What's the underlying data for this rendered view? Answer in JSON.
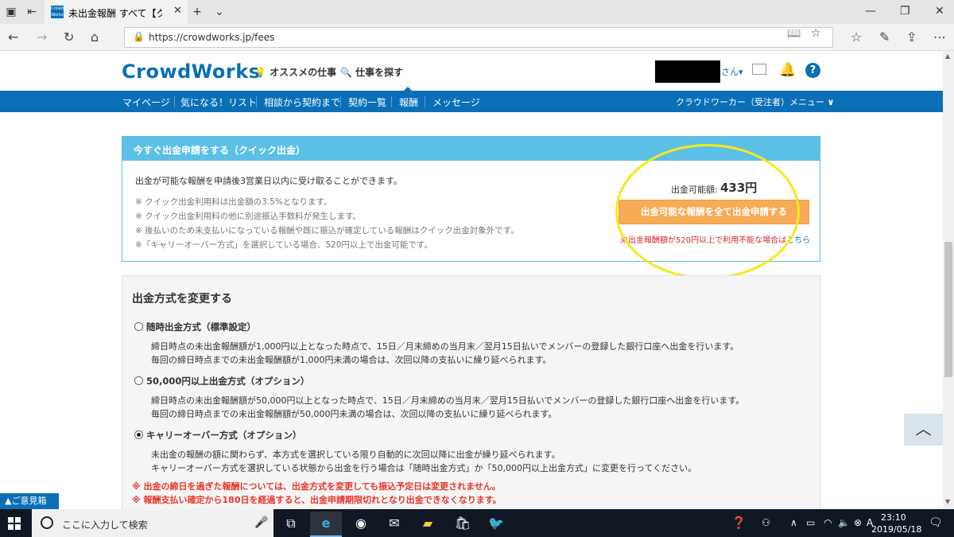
{
  "browser": {
    "tab_title": "未出金報酬 すべて【クラウ",
    "url": "https://crowdworks.jp/fees",
    "icons": [
      "tab-list-icon",
      "back-tab-icon",
      "new-tab-icon",
      "tab-dropdown-icon",
      "minimize-icon",
      "maximize-icon",
      "window-close-icon",
      "back-icon",
      "forward-icon",
      "refresh-icon",
      "home-icon",
      "lock-icon",
      "reading-view-icon",
      "favorite-star-icon",
      "favorites-icon",
      "pen-icon",
      "share-icon",
      "more-icon"
    ]
  },
  "site": {
    "logo": "CrowdWorks",
    "recommended_jobs": "オススメの仕事",
    "find_jobs": "仕事を探す",
    "user_suffix": "さん",
    "nav": [
      "マイページ",
      "気になる！リスト",
      "相談から契約まで",
      "契約一覧",
      "報酬",
      "メッセージ"
    ],
    "nav_active": "報酬",
    "worker_menu": "クラウドワーカー（受注者）メニュー"
  },
  "quick": {
    "title": "今すぐ出金申請をする（クイック出金）",
    "description": "出金が可能な報酬を申請後3営業日以内に受け取ることができます。",
    "notes": [
      "※ クイック出金利用料は出金額の3.5%となります。",
      "※ クイック出金利用料の他に別途振込手数料が発生します。",
      "※ 後払いのため未支払いになっている報酬や既に振込が確定している報酬はクイック出金対象外です。",
      "※「キャリーオーバー方式」を選択している場合、520円以上で出金可能です。"
    ],
    "available_label": "出金可能額:",
    "available_amount": "433円",
    "button": "出金可能な報酬を全て出金申請する",
    "restriction_text": "未出金報酬額が520円以上で利用不能な場合は",
    "restriction_link": "こちら"
  },
  "method": {
    "title": "出金方式を変更する",
    "options": [
      {
        "label": "随時出金方式（標準設定）",
        "lines": [
          "締日時点の未出金報酬額が1,000円以上となった時点で、15日／月末締めの当月末／翌月15日払いでメンバーの登録した銀行口座へ出金を行います。",
          "毎回の締日時点までの未出金報酬額が1,000円未満の場合は、次回以降の支払いに繰り延べられます。"
        ],
        "checked": false
      },
      {
        "label": "50,000円以上出金方式（オプション）",
        "lines": [
          "締日時点の未出金報酬額が50,000円以上となった時点で、15日／月末締めの当月末／翌月15日払いでメンバーの登録した銀行口座へ出金を行います。",
          "毎回の締日時点までの未出金報酬額が50,000円未満の場合は、次回以降の支払いに繰り延べられます。"
        ],
        "checked": false
      },
      {
        "label": "キャリーオーバー方式（オプション）",
        "lines": [
          "未出金の報酬の額に関わらず、本方式を選択している限り自動的に次回以降に出金が繰り延べられます。",
          "キャリーオーバー方式を選択している状態から出金を行う場合は「随時出金方式」か「50,000円以上出金方式」に変更を行ってください。"
        ],
        "checked": true
      }
    ],
    "warnings": [
      "※ 出金の締日を過ぎた報酬については、出金方式を変更しても振込予定日は変更されません。",
      "※ 報酬支払い確定から180日を経過すると、出金申請期限切れとなり出金できなくなります。"
    ]
  },
  "floating": {
    "feedback": "▲ご意見箱",
    "to_top": "︿"
  },
  "taskbar": {
    "search_placeholder": "ここに入力して検索",
    "apps": [
      "task-view-icon",
      "edge-icon",
      "chrome-icon",
      "mail-icon",
      "explorer-icon",
      "store-icon",
      "twitter-icon"
    ],
    "ime": "A",
    "time": "23:10",
    "date": "2019/05/18"
  },
  "colors": {
    "brand_blue": "#0a6fb7",
    "quick_header": "#5cbfe6",
    "button_orange": "#f6ab56",
    "warning_red": "#e8372b",
    "highlight_yellow": "#f4ea1b"
  }
}
